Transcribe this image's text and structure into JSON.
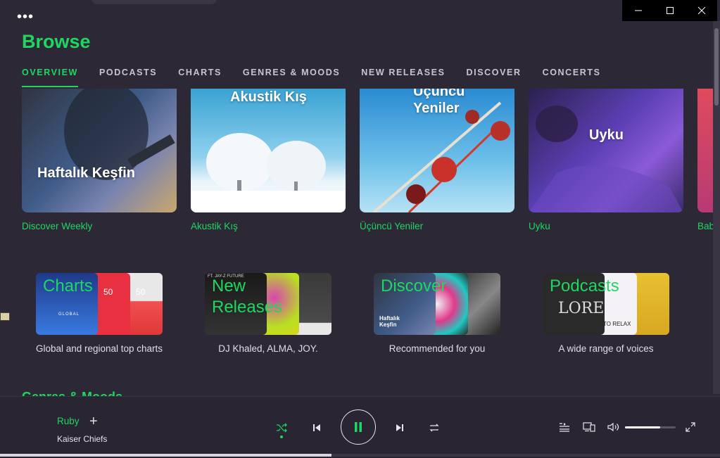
{
  "window": {
    "menu_icon": "more-dots-icon",
    "controls": [
      "minimize-icon",
      "maximize-icon",
      "close-icon"
    ]
  },
  "page": {
    "title": "Browse",
    "tabs": [
      {
        "label": "OVERVIEW",
        "active": true
      },
      {
        "label": "PODCASTS",
        "active": false
      },
      {
        "label": "CHARTS",
        "active": false
      },
      {
        "label": "GENRES & MOODS",
        "active": false
      },
      {
        "label": "NEW RELEASES",
        "active": false
      },
      {
        "label": "DISCOVER",
        "active": false
      },
      {
        "label": "CONCERTS",
        "active": false
      }
    ]
  },
  "featured": [
    {
      "cover_text": "Haftalık Keşfin",
      "label": "Discover Weekly"
    },
    {
      "cover_text": "Akustik Kış",
      "label": "Akustik Kış"
    },
    {
      "cover_text": "Üçüncü Yeniler",
      "label": "Üçüncü Yeniler"
    },
    {
      "cover_text": "Uyku",
      "label": "Uyku"
    },
    {
      "cover_text": "",
      "label": "Bab"
    }
  ],
  "categories": [
    {
      "name": "Charts",
      "description": "Global and regional top charts",
      "art_text": [
        "GLOBAL",
        "50",
        "50"
      ]
    },
    {
      "name": "New Releases",
      "description": "DJ Khaled, ALMA, JOY.",
      "art_text": [
        "FT. JAY-Z FUTURE"
      ]
    },
    {
      "name": "Discover",
      "description": "Recommended for you",
      "art_text": [
        "Haftalık Keşfin"
      ]
    },
    {
      "name": "Podcasts",
      "description": "A wide range of voices",
      "art_text": [
        "LORE",
        "TO RELAX"
      ]
    }
  ],
  "genres_heading": "Genres & Moods",
  "player": {
    "track": "Ruby",
    "artist": "Kaiser Chiefs",
    "add_icon": "plus-icon",
    "controls": {
      "shuffle": "shuffle-icon",
      "previous": "previous-icon",
      "play_pause": "pause-icon",
      "next": "next-icon",
      "repeat": "repeat-icon"
    },
    "right_icons": [
      "queue-icon",
      "devices-icon",
      "volume-icon",
      "fullscreen-icon"
    ],
    "volume": 0.7,
    "progress": 0.46
  },
  "colors": {
    "accent": "#1ed760",
    "background": "#2d2836",
    "player_bg": "#2a2533"
  }
}
